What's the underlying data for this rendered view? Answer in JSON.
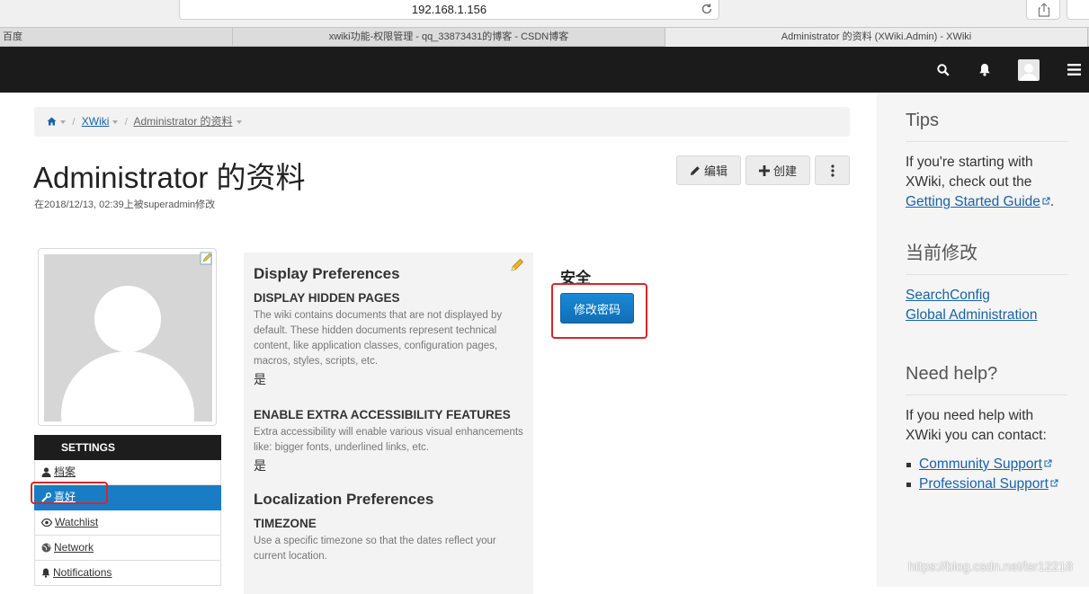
{
  "browser": {
    "address": "192.168.1.156",
    "tabs": [
      {
        "label": "百度"
      },
      {
        "label": "xwiki功能-权限管理 - qq_33873431的博客 - CSDN博客"
      },
      {
        "label": "Administrator 的资料 (XWiki.Admin) - XWiki"
      }
    ]
  },
  "breadcrumb": {
    "wiki": "XWiki",
    "page": "Administrator 的资料"
  },
  "page": {
    "title": "Administrator 的资料",
    "modified": "在2018/12/13, 02:39上被superadmin修改",
    "edit_label": "编辑",
    "create_label": "创建"
  },
  "settings": {
    "heading": "SETTINGS",
    "items": [
      {
        "label": "档案",
        "icon": "user-icon"
      },
      {
        "label": "喜好",
        "icon": "wrench-icon"
      },
      {
        "label": "Watchlist",
        "icon": "eye-icon"
      },
      {
        "label": "Network",
        "icon": "globe-icon"
      },
      {
        "label": "Notifications",
        "icon": "bell-icon"
      }
    ]
  },
  "display_prefs": {
    "title": "Display Preferences",
    "hidden_pages": {
      "heading": "DISPLAY HIDDEN PAGES",
      "desc": "The wiki contains documents that are not displayed by default. These hidden documents represent technical content, like application classes, configuration pages, macros, styles, scripts, etc.",
      "value": "是"
    },
    "accessibility": {
      "heading": "ENABLE EXTRA ACCESSIBILITY FEATURES",
      "desc": "Extra accessibility will enable various visual enhancements like: bigger fonts, underlined links, etc.",
      "value": "是"
    }
  },
  "localization_prefs": {
    "title": "Localization Preferences",
    "timezone": {
      "heading": "TIMEZONE",
      "desc": "Use a specific timezone so that the dates reflect your current location."
    }
  },
  "security": {
    "title": "安全",
    "change_password": "修改密码"
  },
  "sidebar": {
    "tips": {
      "title": "Tips",
      "text": "If you're starting with XWiki, check out the",
      "link": "Getting Started Guide",
      "after": "."
    },
    "recent": {
      "title": "当前修改",
      "links": [
        "SearchConfig",
        "Global Administration"
      ]
    },
    "help": {
      "title": "Need help?",
      "text": "If you need help with XWiki you can contact:",
      "links": [
        "Community Support",
        "Professional Support"
      ]
    }
  },
  "watermark": "https://blog.csdn.net/lsr12218",
  "colors": {
    "accent": "#1a7cc4",
    "nav": "#1b1b1b",
    "highlight": "#d8262a",
    "link": "#1a62a8"
  }
}
